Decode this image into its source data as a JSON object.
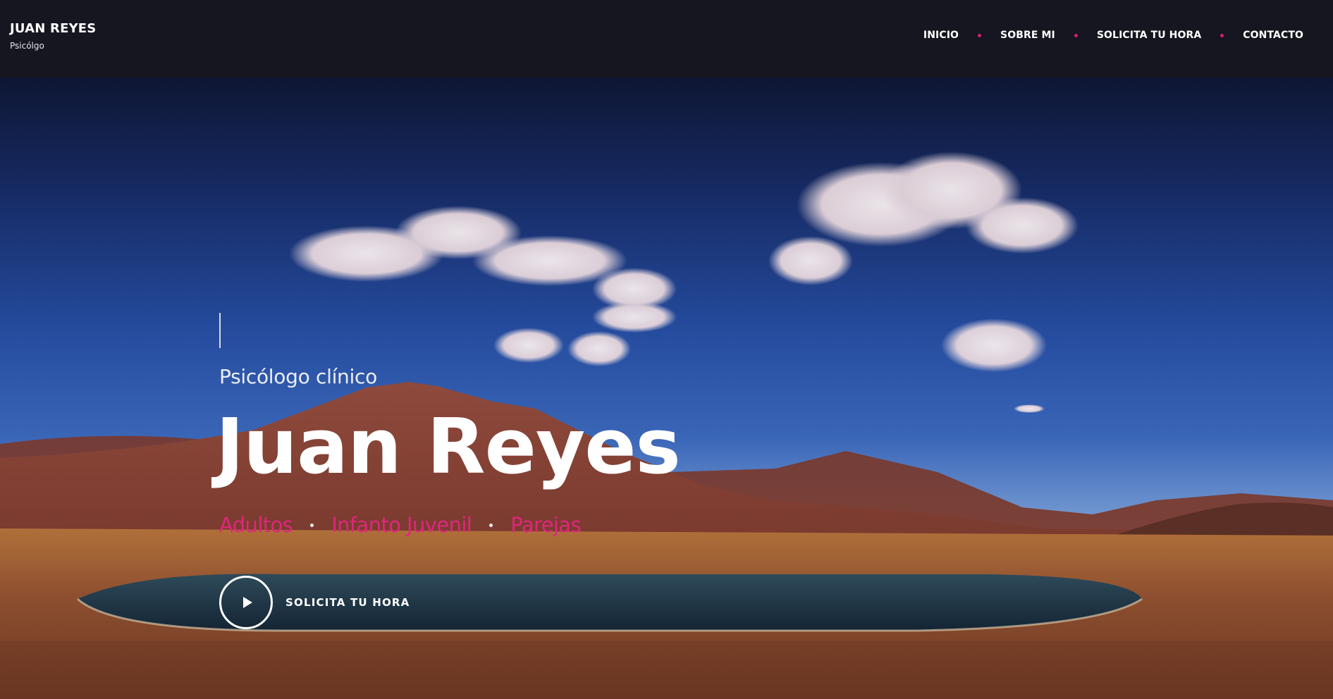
{
  "header": {
    "brand_name": "JUAN REYES",
    "brand_subtitle": "Psicólgo",
    "nav": [
      {
        "label": "INICIO"
      },
      {
        "label": "SOBRE MI"
      },
      {
        "label": "SOLICITA TU HORA"
      },
      {
        "label": "CONTACTO"
      }
    ]
  },
  "hero": {
    "subtitle": "Psicólogo clínico",
    "title": "Juan Reyes",
    "specialties": [
      "Adultos",
      "Infanto Juvenil",
      "Parejas"
    ],
    "cta_label": "SOLICITA TU HORA"
  },
  "colors": {
    "accent": "#e0267c",
    "header_bg": "#15161f",
    "text": "#ffffff"
  }
}
